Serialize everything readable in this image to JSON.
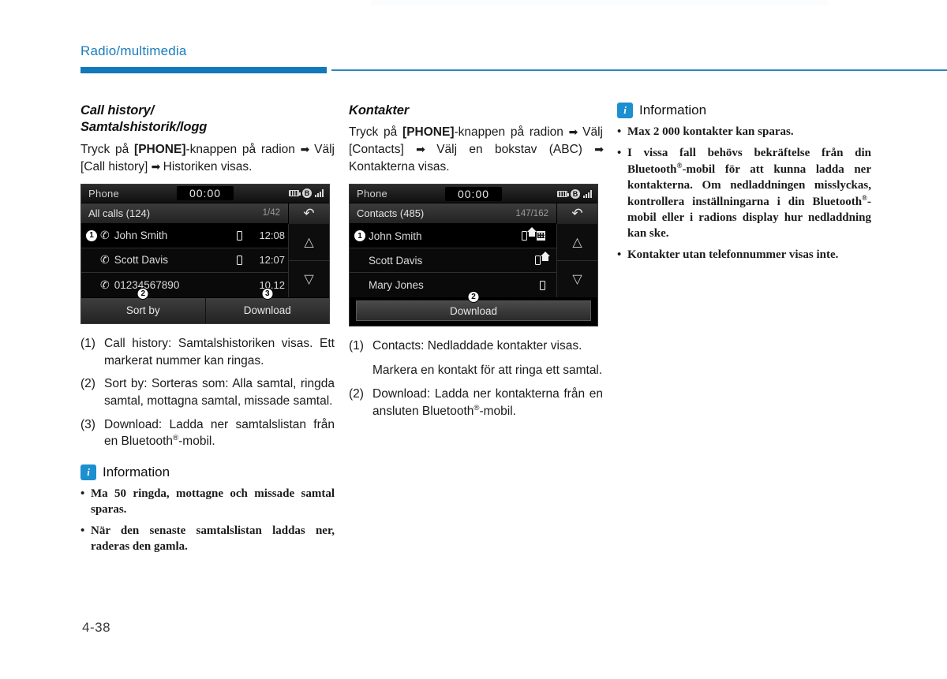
{
  "header": {
    "title": "Radio/multimedia"
  },
  "page_number": "4-38",
  "col1": {
    "heading_line1": "Call history/",
    "heading_line2": "Samtalshistorik/logg",
    "intro_1": "Tryck på ",
    "intro_bold": "[PHONE]",
    "intro_2": "-knappen på radion ",
    "intro_3": " Välj [Call history] ",
    "intro_4": " Historiken visas.",
    "device": {
      "title": "Phone",
      "clock": "00:00",
      "subtitle": "All calls (124)",
      "page_indicator": "1/42",
      "back_icon": "back-arrow-icon",
      "rows": [
        {
          "num": "1",
          "call_icon": "call-incoming-icon",
          "name": "John Smith",
          "types": [
            "mobile"
          ],
          "time": "12:08"
        },
        {
          "num": "",
          "call_icon": "call-outgoing-icon",
          "name": "Scott Davis",
          "types": [
            "mobile"
          ],
          "time": "12:07"
        },
        {
          "num": "",
          "call_icon": "call-missed-icon",
          "name": "01234567890",
          "types": [],
          "time": "10.12"
        }
      ],
      "scroll_up": "chevron-up-icon",
      "scroll_down": "chevron-down-icon",
      "buttons": [
        {
          "label": "Sort by",
          "callout": "2"
        },
        {
          "label": "Download",
          "callout": "3"
        }
      ]
    },
    "list": [
      {
        "mark": "(1)",
        "text": "Call history: Samtalshistoriken visas. Ett markerat nummer kan ringas."
      },
      {
        "mark": "(2)",
        "text": "Sort by: Sorteras som: Alla samtal, ringda samtal, mottagna samtal, missade samtal."
      },
      {
        "mark": "(3)",
        "text": "Download: Ladda ner samtalslistan från en Bluetooth®-mobil."
      }
    ],
    "info": {
      "label": "Information",
      "icon": "info-icon",
      "items": [
        "Ma 50 ringda, mottagne och missade samtal sparas.",
        "När den senaste samtalslistan laddas ner, raderas den gamla."
      ]
    }
  },
  "col2": {
    "heading": "Kontakter",
    "intro_1": "Tryck på ",
    "intro_bold": "[PHONE]",
    "intro_2": "-knappen på radion ",
    "intro_3": " Välj [Contacts] ",
    "intro_4": " Välj en bokstav (ABC) ",
    "intro_5": " Kontakterna visas.",
    "device": {
      "title": "Phone",
      "clock": "00:00",
      "subtitle": "Contacts (485)",
      "page_indicator": "147/162",
      "back_icon": "back-arrow-icon",
      "rows": [
        {
          "num": "1",
          "name": "John Smith",
          "types": [
            "mobile",
            "home",
            "office"
          ]
        },
        {
          "num": "",
          "name": "Scott Davis",
          "types": [
            "mobile",
            "home"
          ]
        },
        {
          "num": "",
          "name": "Mary Jones",
          "types": [
            "mobile"
          ]
        }
      ],
      "scroll_up": "chevron-up-icon",
      "scroll_down": "chevron-down-icon",
      "button": {
        "label": "Download",
        "callout": "2"
      }
    },
    "list": [
      {
        "mark": "(1)",
        "text": "Contacts: Nedladdade kontakter visas.",
        "sub": "Markera en kontakt för att ringa ett samtal."
      },
      {
        "mark": "(2)",
        "text": "Download: Ladda ner kontakterna från en ansluten Bluetooth®-mobil."
      }
    ]
  },
  "col3": {
    "info": {
      "label": "Information",
      "icon": "info-icon",
      "items": [
        "Max 2 000 kontakter kan sparas.",
        "I vissa fall behövs bekräftelse från din Bluetooth®-mobil för att kunna ladda ner kontakterna. Om nedladdningen misslyckas, kontrollera inställningarna i din Bluetooth®-mobil eller i radions display hur nedladdning kan ske.",
        "Kontakter utan telefonnummer visas inte."
      ]
    }
  },
  "colors": {
    "accent": "#1278bb",
    "info_badge": "#1c8fd0",
    "text": "#1a1a1a"
  }
}
